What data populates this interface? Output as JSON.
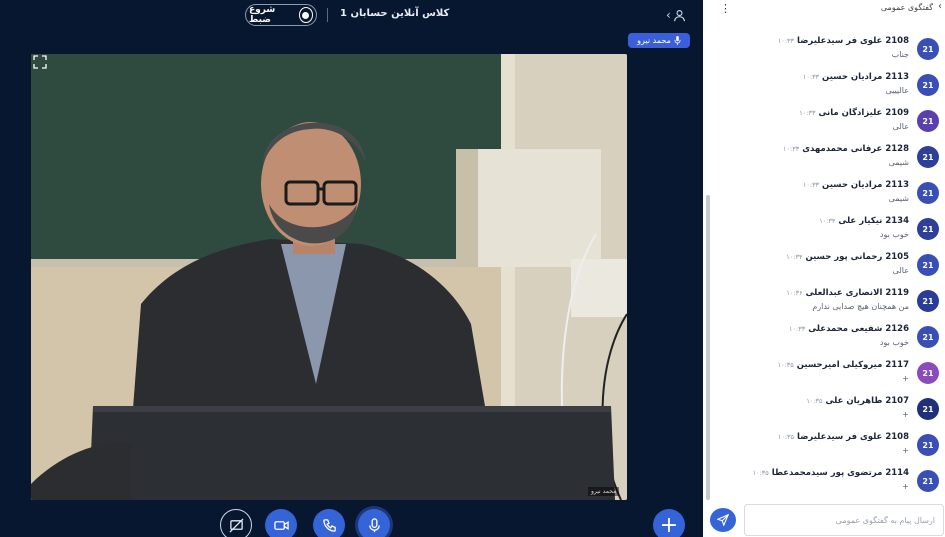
{
  "header": {
    "title": "کلاس آنلاین حسابان 1",
    "record_label": "شروع ضبط",
    "users_icon": "users-icon"
  },
  "presenter": {
    "name": "محمد نیرو"
  },
  "video": {
    "camera_label": "محمد نیرو"
  },
  "controls": {
    "icons": [
      "screen-share-off-icon",
      "camera-icon",
      "phone-icon",
      "microphone-icon"
    ],
    "add_icon": "plus-icon"
  },
  "chat": {
    "title": "گفتگوی عمومی",
    "input_placeholder": "ارسال پیام به گفتگوی عمومی",
    "messages": [
      {
        "avatar": "21",
        "color": "#3a4fb5",
        "name": "2108 علوی فر سیدعلیرضا",
        "time": "۱۰:۳۳",
        "text": "جناب"
      },
      {
        "avatar": "21",
        "color": "#3a4fb5",
        "name": "2113 مرادیان حسین",
        "time": "۱۰:۳۳",
        "text": "عالیییی"
      },
      {
        "avatar": "21",
        "color": "#5a3fb0",
        "name": "2109 علیزادگان مانی",
        "time": "۱۰:۳۳",
        "text": "عالی"
      },
      {
        "avatar": "21",
        "color": "#2e3f9a",
        "name": "2128 عرفانی محمدمهدی",
        "time": "۱۰:۳۳",
        "text": "شیمی"
      },
      {
        "avatar": "21",
        "color": "#3a4fb5",
        "name": "2113 مرادیان حسین",
        "time": "۱۰:۳۳",
        "text": "شیمی"
      },
      {
        "avatar": "21",
        "color": "#2e3f9a",
        "name": "2134 نیکیار علی",
        "time": "۱۰:۳۴",
        "text": "خوب بود"
      },
      {
        "avatar": "21",
        "color": "#3a4fb5",
        "name": "2105 رحمانی پور حسین",
        "time": "۱۰:۳۴",
        "text": "عالی"
      },
      {
        "avatar": "21",
        "color": "#2a3c9a",
        "name": "2119 الانصاری عبدالعلی",
        "time": "۱۰:۳۶",
        "text": "من همچنان هیچ صدایی ندارم"
      },
      {
        "avatar": "21",
        "color": "#3a4fb5",
        "name": "2126 شفیعی محمدعلی",
        "time": "۱۰:۳۳",
        "text": "خوب بود"
      },
      {
        "avatar": "21",
        "color": "#8a4bbd",
        "name": "2117 میروکیلی امیرحسین",
        "time": "۱۰:۳۵",
        "text": "+"
      },
      {
        "avatar": "21",
        "color": "#1f2f7a",
        "name": "2107 طاهریان علی",
        "time": "۱۰:۳۵",
        "text": "+"
      },
      {
        "avatar": "21",
        "color": "#3a4fb5",
        "name": "2108 علوی فر سیدعلیرضا",
        "time": "۱۰:۳۵",
        "text": "+"
      },
      {
        "avatar": "21",
        "color": "#3a4fb5",
        "name": "2114 مرتضوی پور سیدمحمدعطا",
        "time": "۱۰:۳۵",
        "text": "+"
      }
    ]
  }
}
